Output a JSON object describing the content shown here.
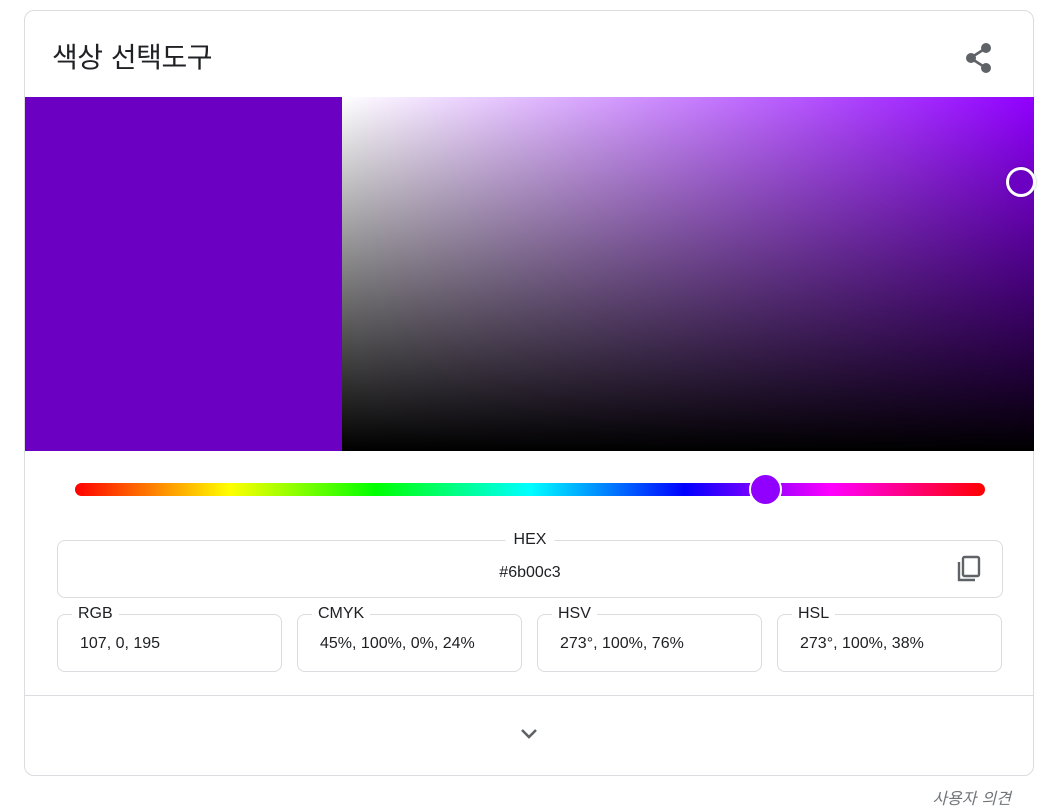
{
  "widget": {
    "title": "색상 선택도구",
    "selected_color": "#6b00c3",
    "hue_color": "#9100ff",
    "hue_degrees": 273,
    "saturation_pct": 100,
    "value_pct": 76
  },
  "hex": {
    "label": "HEX",
    "value": "#6b00c3"
  },
  "fields": [
    {
      "label": "RGB",
      "value": "107, 0, 195"
    },
    {
      "label": "CMYK",
      "value": "45%, 100%, 0%, 24%"
    },
    {
      "label": "HSV",
      "value": "273°, 100%, 76%"
    },
    {
      "label": "HSL",
      "value": "273°, 100%, 38%"
    }
  ],
  "icons": {
    "share": "share-icon",
    "copy": "copy-icon",
    "expand": "chevron-down-icon"
  },
  "footer": {
    "feedback_label": "사용자 의견"
  }
}
